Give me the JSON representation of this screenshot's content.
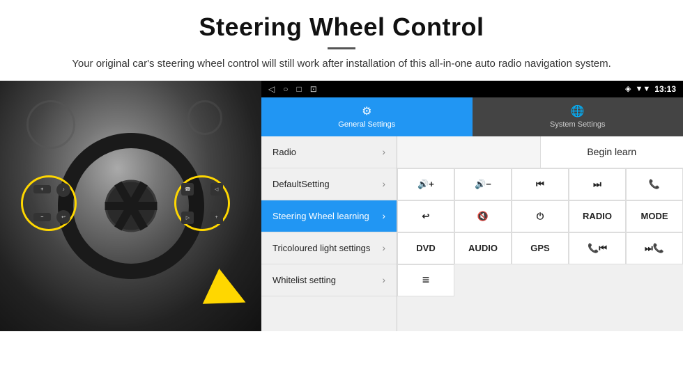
{
  "header": {
    "title": "Steering Wheel Control",
    "description": "Your original car's steering wheel control will still work after installation of this all-in-one auto radio navigation system."
  },
  "status_bar": {
    "icons_left": [
      "◁",
      "○",
      "□",
      "⊡"
    ],
    "location_icon": "◈",
    "signal_icon": "▼",
    "time": "13:13"
  },
  "tabs": [
    {
      "id": "general",
      "label": "General Settings",
      "icon": "⚙",
      "active": true
    },
    {
      "id": "system",
      "label": "System Settings",
      "icon": "🌐",
      "active": false
    }
  ],
  "menu_items": [
    {
      "id": "radio",
      "label": "Radio",
      "active": false
    },
    {
      "id": "default-setting",
      "label": "DefaultSetting",
      "active": false
    },
    {
      "id": "steering-wheel",
      "label": "Steering Wheel learning",
      "active": true
    },
    {
      "id": "tricoloured",
      "label": "Tricoloured light settings",
      "active": false
    },
    {
      "id": "whitelist",
      "label": "Whitelist setting",
      "active": false
    }
  ],
  "controls": {
    "begin_learn_label": "Begin learn",
    "grid_buttons": [
      "🔊+",
      "🔊-",
      "⏮",
      "⏭",
      "📞",
      "↩",
      "🔊×",
      "⏻",
      "RADIO",
      "MODE",
      "DVD",
      "AUDIO",
      "GPS",
      "📞⏮",
      "⏭📞"
    ],
    "bottom_icon": "≡"
  }
}
